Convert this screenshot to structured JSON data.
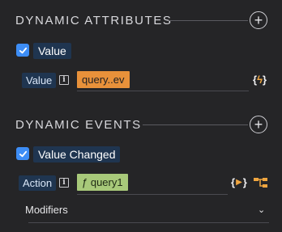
{
  "attributes": {
    "title": "DYNAMIC ATTRIBUTES",
    "checkbox_label": "Value",
    "field_label": "Value",
    "token": "query..ev",
    "dyn_glyph": "{ϟ}"
  },
  "events": {
    "title": "DYNAMIC EVENTS",
    "checkbox_label": "Value Changed",
    "field_label": "Action",
    "token": "ƒ query1",
    "dyn_glyph": "{▶}",
    "modifiers_label": "Modifiers"
  },
  "colors": {
    "background": "#252527",
    "accent": "#3d8df5",
    "token_orange": "#e8913a",
    "token_green": "#a8c97a"
  },
  "icons": [
    "add-circle-icon",
    "check-icon",
    "info-icon",
    "lightning-icon",
    "workflow-icon",
    "chevron-down-icon"
  ]
}
